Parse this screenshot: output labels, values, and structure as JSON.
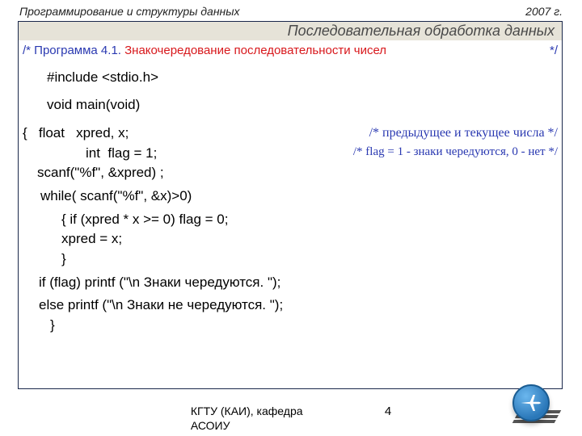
{
  "header": {
    "course": "Программирование  и структуры данных",
    "year": "2007 г."
  },
  "title_band": "Последовательная обработка данных",
  "program_header": {
    "prefix": "/* Программа 4.1.",
    "highlight": "Знакочередование   последовательности чисел",
    "suffix": "*/"
  },
  "code": {
    "include": "#include <stdio.h>",
    "main_sig": "void main(void)",
    "decl_line_lhs": "{   float   xpred, x;",
    "decl_line_cmt": "/* предыдущее и текущее  числа                  */",
    "flag_line_lhs": "int  flag = 1;",
    "flag_line_cmt": "/* flag = 1 - знаки чередуются, 0 - нет */",
    "scanf1": "scanf(\"%f\", &xpred) ;",
    "while": "while( scanf(\"%f\", &x)>0)",
    "ifline": "{    if (xpred * x >= 0) flag = 0;",
    "assign": "xpred = x;",
    "brace_close_inner": "}",
    "if_flag": "if (flag) printf (\"\\n Знаки чередуются. \");",
    "else_line": "else printf (\"\\n Знаки не чередуются. \");",
    "brace_close_outer": "}"
  },
  "footer": {
    "org": "КГТУ  (КАИ),  кафедра АСОИУ",
    "page": "4"
  }
}
